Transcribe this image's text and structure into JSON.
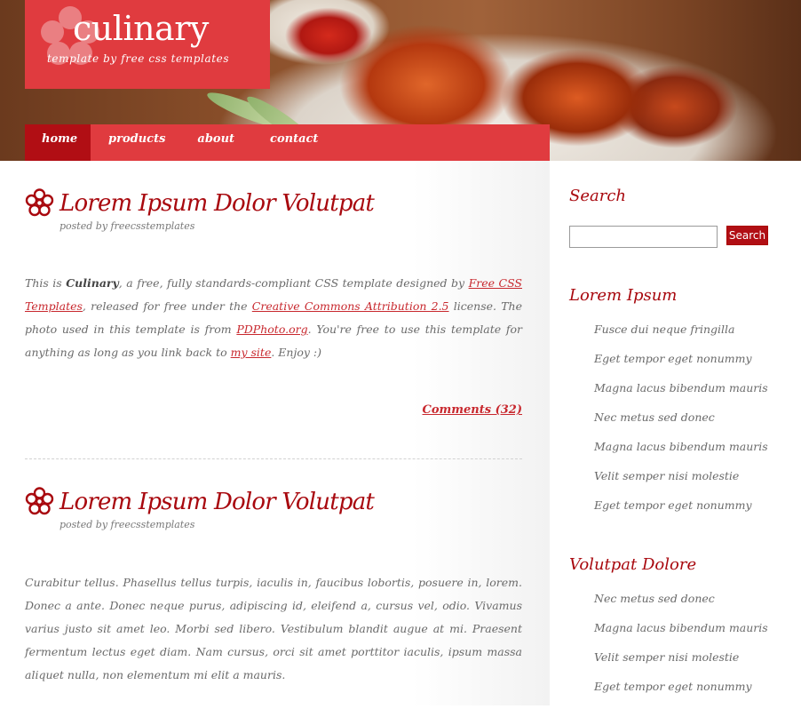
{
  "header": {
    "logo_title": "culinary",
    "logo_tagline": "template by free css templates",
    "accent_color": "#e03b3f",
    "accent_dark": "#b10e14"
  },
  "menu": {
    "items": [
      {
        "label": "home",
        "active": true
      },
      {
        "label": "products",
        "active": false
      },
      {
        "label": "about",
        "active": false
      },
      {
        "label": "contact",
        "active": false
      }
    ]
  },
  "posts": [
    {
      "title": "Lorem Ipsum Dolor Volutpat",
      "byline": "posted by freecsstemplates",
      "body": {
        "t1": "This is ",
        "bold": "Culinary",
        "t2": ", a free, fully standards-compliant CSS template designed by ",
        "link1": "Free CSS Templates",
        "t3": ", released for free under the ",
        "link2": "Creative Commons Attribution 2.5",
        "t4": " license. The photo used in this template is from ",
        "link3": "PDPhoto.org",
        "t5": ". You're free to use this template for anything as long as you link back to ",
        "link4": "my site",
        "t6": ". Enjoy :)"
      },
      "comments": "Comments (32)"
    },
    {
      "title": "Lorem Ipsum Dolor Volutpat",
      "byline": "posted by freecsstemplates",
      "body_text": "Curabitur tellus. Phasellus tellus turpis, iaculis in, faucibus lobortis, posuere in, lorem. Donec a ante. Donec neque purus, adipiscing id, eleifend a, cursus vel, odio. Vivamus varius justo sit amet leo. Morbi sed libero. Vestibulum blandit augue at mi. Praesent fermentum lectus eget diam. Nam cursus, orci sit amet porttitor iaculis, ipsum massa aliquet nulla, non elementum mi elit a mauris."
    }
  ],
  "sidebar": {
    "search_heading": "Search",
    "search_value": "",
    "search_button": "Search",
    "section1": {
      "heading": "Lorem Ipsum",
      "items": [
        "Fusce dui neque fringilla",
        "Eget tempor eget nonummy",
        "Magna lacus bibendum mauris",
        "Nec metus sed donec",
        "Magna lacus bibendum mauris",
        "Velit semper nisi molestie",
        "Eget tempor eget nonummy"
      ]
    },
    "section2": {
      "heading": "Volutpat Dolore",
      "items": [
        "Nec metus sed donec",
        "Magna lacus bibendum mauris",
        "Velit semper nisi molestie",
        "Eget tempor eget nonummy"
      ]
    }
  }
}
